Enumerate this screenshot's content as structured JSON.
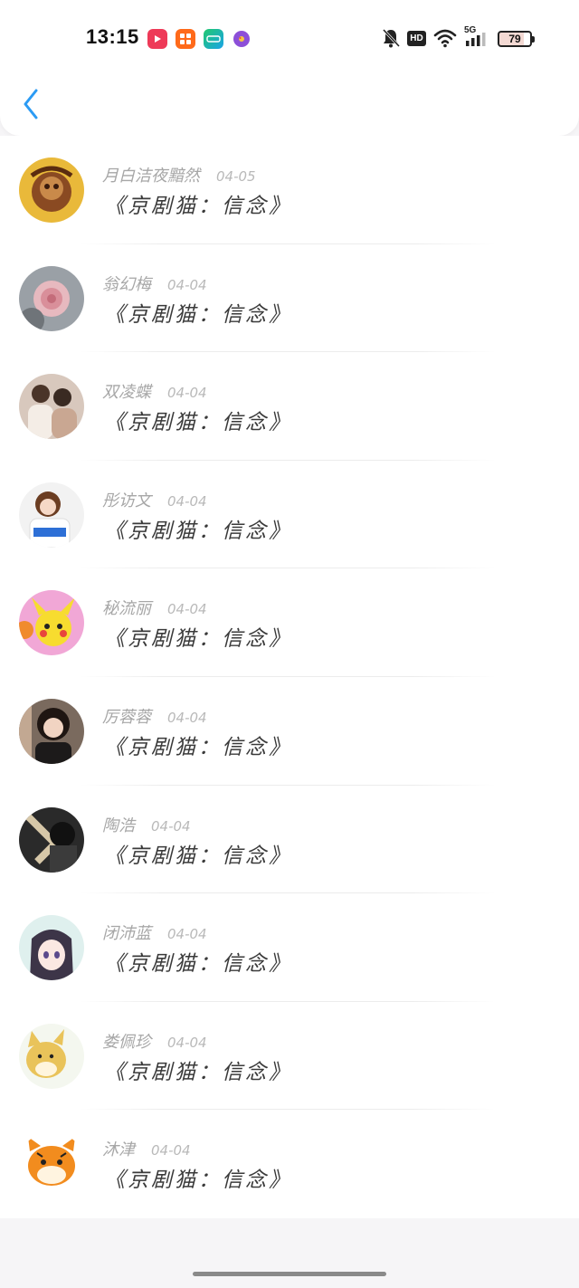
{
  "status_bar": {
    "time": "13:15",
    "network": "5G",
    "hd_label": "HD",
    "battery": "79",
    "app_icons": [
      "video-app-icon",
      "grid-app-icon",
      "iqiyi-app-icon",
      "game-app-icon"
    ]
  },
  "header": {
    "back_icon": "chevron-left-icon"
  },
  "comments": [
    {
      "name": "月白洁夜黯然",
      "date": "04-05",
      "text": "《京剧猫：信念》"
    },
    {
      "name": "翁幻梅",
      "date": "04-04",
      "text": "《京剧猫：信念》"
    },
    {
      "name": "双凌蝶",
      "date": "04-04",
      "text": "《京剧猫：信念》"
    },
    {
      "name": "彤访文",
      "date": "04-04",
      "text": "《京剧猫：信念》"
    },
    {
      "name": "秘流丽",
      "date": "04-04",
      "text": "《京剧猫：信念》"
    },
    {
      "name": "厉蓉蓉",
      "date": "04-04",
      "text": "《京剧猫：信念》"
    },
    {
      "name": "陶浩",
      "date": "04-04",
      "text": "《京剧猫：信念》"
    },
    {
      "name": "闭沛蓝",
      "date": "04-04",
      "text": "《京剧猫：信念》"
    },
    {
      "name": "娄佩珍",
      "date": "04-04",
      "text": "《京剧猫：信念》"
    },
    {
      "name": "沐津",
      "date": "04-04",
      "text": "《京剧猫：信念》"
    }
  ],
  "colors": {
    "accent": "#2b9bf4",
    "background": "#f6f5f7",
    "name": "#a7a7a7",
    "text": "#3a3a3a"
  }
}
